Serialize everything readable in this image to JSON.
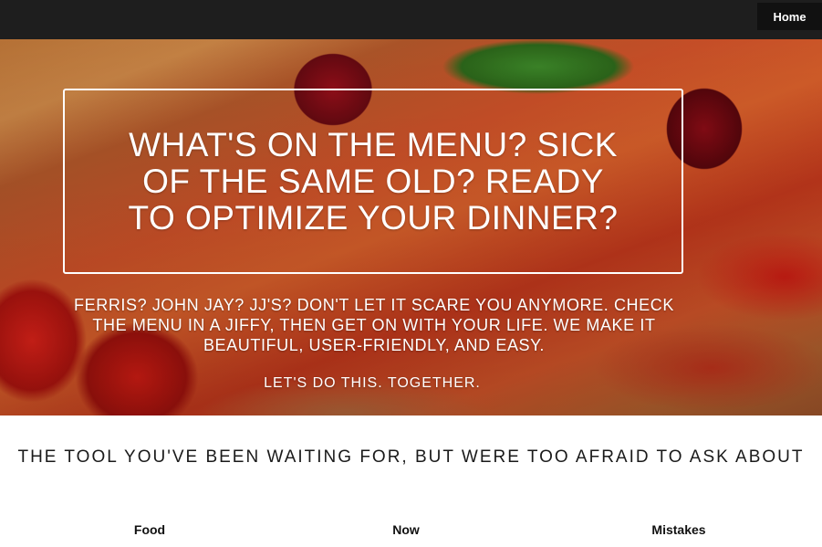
{
  "nav": {
    "home_label": "Home"
  },
  "hero": {
    "title": "WHAT'S ON THE MENU? SICK OF THE SAME OLD? READY TO OPTIMIZE YOUR DINNER?",
    "subtitle": "FERRIS? JOHN JAY? JJ'S? DON'T LET IT SCARE YOU ANYMORE. CHECK THE MENU IN A JIFFY, THEN GET ON WITH YOUR LIFE. WE MAKE IT BEAUTIFUL, USER-FRIENDLY, AND EASY.",
    "cta": "LET'S DO THIS. TOGETHER."
  },
  "section": {
    "tagline": "THE TOOL YOU'VE BEEN WAITING FOR, BUT WERE TOO AFRAID TO ASK ABOUT",
    "features": [
      {
        "label": "Food"
      },
      {
        "label": "Now"
      },
      {
        "label": "Mistakes"
      }
    ]
  }
}
